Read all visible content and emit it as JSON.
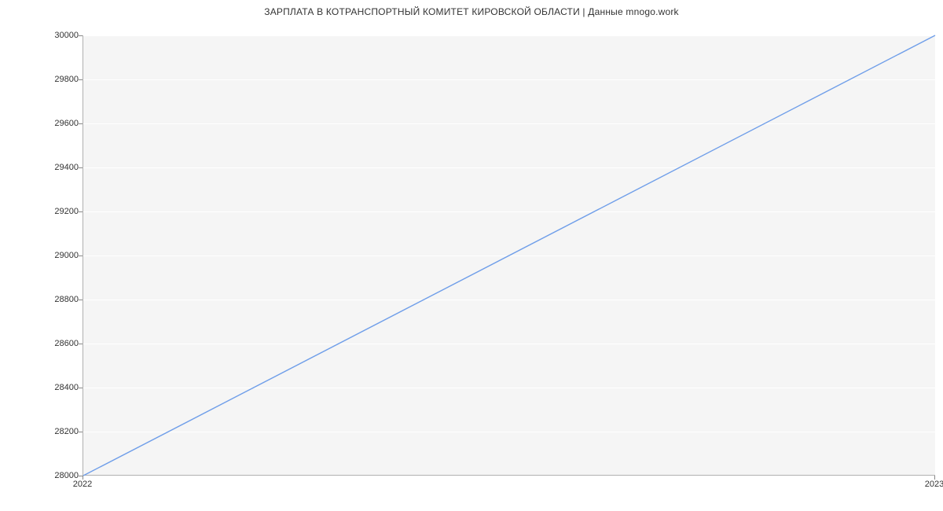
{
  "chart_data": {
    "type": "line",
    "title": "ЗАРПЛАТА В КОТРАНСПОРТНЫЙ КОМИТЕТ КИРОВСКОЙ ОБЛАСТИ | Данные mnogo.work",
    "x": [
      2022,
      2023
    ],
    "values": [
      28000,
      30000
    ],
    "x_ticks": [
      2022,
      2023
    ],
    "y_ticks": [
      28000,
      28200,
      28400,
      28600,
      28800,
      29000,
      29200,
      29400,
      29600,
      29800,
      30000
    ],
    "xlabel": "",
    "ylabel": "",
    "xlim": [
      2022,
      2023
    ],
    "ylim": [
      28000,
      30000
    ],
    "line_color": "#6f9ee9",
    "plot_bg": "#f5f5f5"
  }
}
